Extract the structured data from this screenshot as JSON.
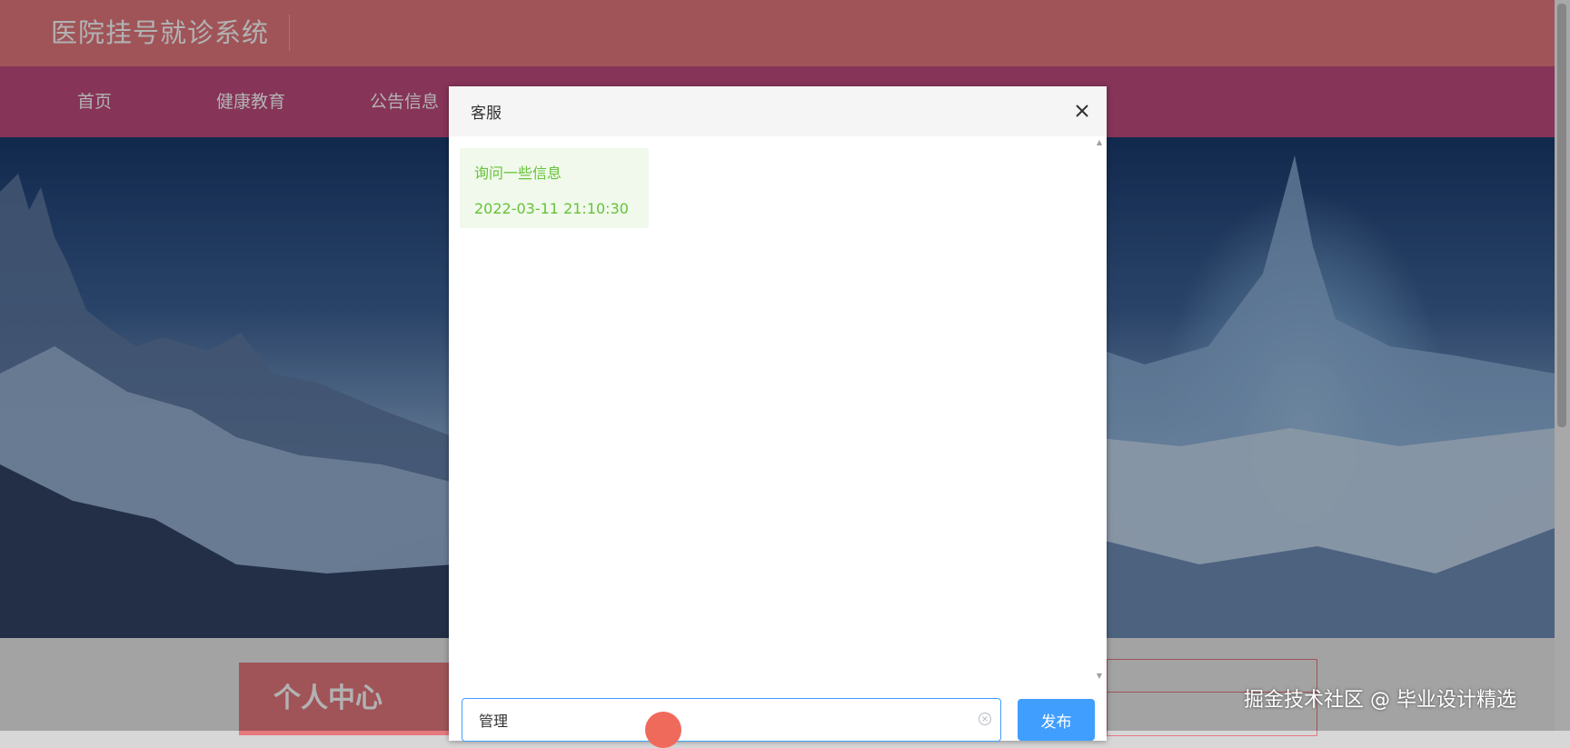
{
  "site": {
    "title": "医院挂号就诊系统"
  },
  "nav": {
    "items": [
      {
        "label": "首页"
      },
      {
        "label": "健康教育"
      },
      {
        "label": "公告信息"
      }
    ]
  },
  "personal_center": {
    "label": "个人中心"
  },
  "dialog": {
    "title": "客服",
    "messages": [
      {
        "text": "询问一些信息",
        "time": "2022-03-11 21:10:30"
      }
    ],
    "input": {
      "value": "管理"
    },
    "publish_label": "发布"
  },
  "watermark": "掘金技术社区 @ 毕业设计精选",
  "colors": {
    "topbar": "#e6797f",
    "navbar": "#c04b7f",
    "primary": "#409eff",
    "message_text": "#67c23a",
    "message_bg": "#f0f9eb"
  }
}
